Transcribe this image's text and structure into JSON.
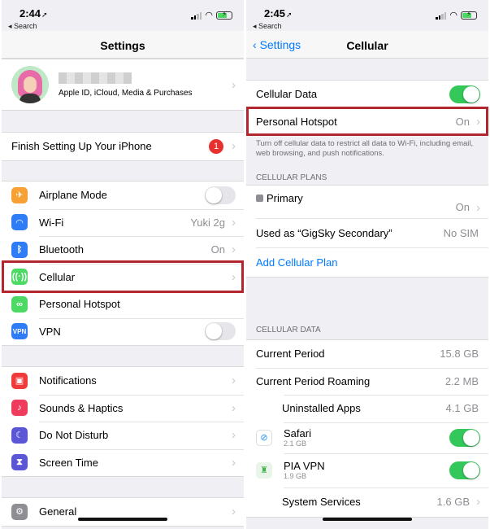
{
  "left": {
    "status": {
      "time": "2:44",
      "back": "◂ Search"
    },
    "title": "Settings",
    "profile_subtitle": "Apple ID, iCloud, Media & Purchases",
    "finish_setup": {
      "label": "Finish Setting Up Your iPhone",
      "badge": "1"
    },
    "items": [
      {
        "label": "Airplane Mode",
        "icon": "airplane-icon",
        "color": "#f7a033"
      },
      {
        "label": "Wi-Fi",
        "value": "Yuki 2g",
        "icon": "wifi-icon",
        "color": "#2f7df6"
      },
      {
        "label": "Bluetooth",
        "value": "On",
        "icon": "bluetooth-icon",
        "color": "#2f7df6"
      },
      {
        "label": "Cellular",
        "icon": "cellular-icon",
        "color": "#4cd964"
      },
      {
        "label": "Personal Hotspot",
        "icon": "hotspot-icon",
        "color": "#4cd964"
      },
      {
        "label": "VPN",
        "icon": "vpn-icon",
        "color": "#2f7df6"
      }
    ],
    "items2": [
      {
        "label": "Notifications",
        "icon": "notifications-icon",
        "color": "#ef3b39"
      },
      {
        "label": "Sounds & Haptics",
        "icon": "sounds-icon",
        "color": "#ef3b5c"
      },
      {
        "label": "Do Not Disturb",
        "icon": "moon-icon",
        "color": "#5b56d6"
      },
      {
        "label": "Screen Time",
        "icon": "hourglass-icon",
        "color": "#5b56d6"
      }
    ],
    "general": {
      "label": "General",
      "icon": "gear-icon",
      "color": "#8e8e93"
    }
  },
  "right": {
    "status": {
      "time": "2:45",
      "back": "◂ Search"
    },
    "back_label": "Settings",
    "title": "Cellular",
    "cellular_data_label": "Cellular Data",
    "hotspot": {
      "label": "Personal Hotspot",
      "value": "On"
    },
    "footnote": "Turn off cellular data to restrict all data to Wi-Fi, including email, web browsing, and push notifications.",
    "plans_header": "CELLULAR PLANS",
    "primary": {
      "label": "Primary",
      "value": "On"
    },
    "used_as": {
      "label": "Used as “GigSky Secondary”",
      "value": "No SIM"
    },
    "add_plan": "Add Cellular Plan",
    "data_header": "CELLULAR DATA",
    "current_period": {
      "label": "Current Period",
      "value": "15.8 GB"
    },
    "roaming": {
      "label": "Current Period Roaming",
      "value": "2.2 MB"
    },
    "uninstalled": {
      "label": "Uninstalled Apps",
      "value": "4.1 GB"
    },
    "safari": {
      "label": "Safari",
      "sub": "2.1 GB"
    },
    "pia": {
      "label": "PIA VPN",
      "sub": "1.9 GB"
    },
    "system": {
      "label": "System Services",
      "value": "1.6 GB"
    }
  }
}
